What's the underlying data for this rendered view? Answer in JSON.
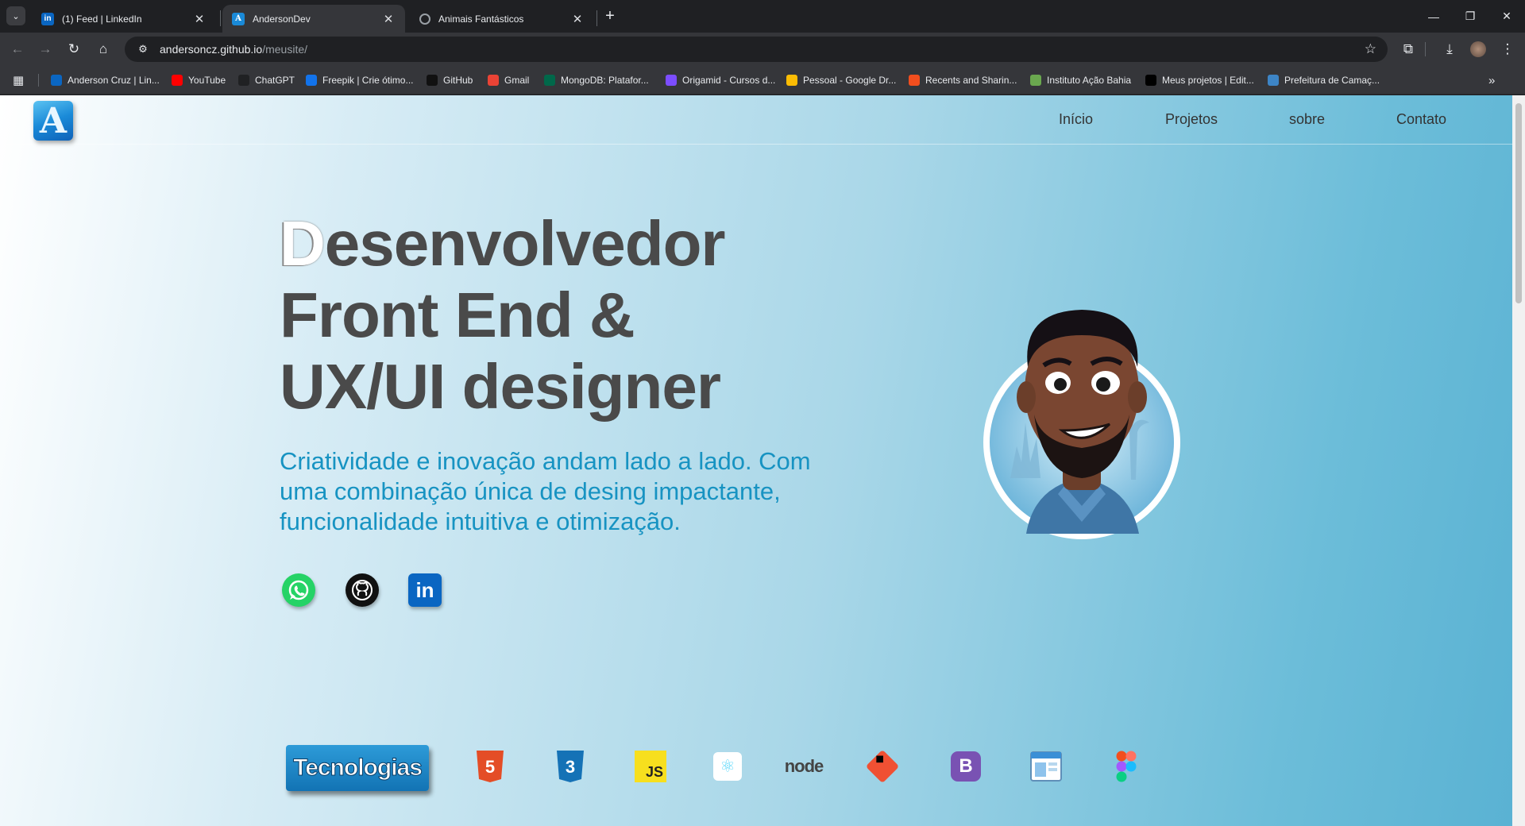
{
  "browser": {
    "tabs": [
      {
        "title": "(1) Feed | LinkedIn",
        "active": false,
        "favicon": "linkedin-icon",
        "color": "#0a66c2"
      },
      {
        "title": "AndersonDev",
        "active": true,
        "favicon": "site-logo-icon",
        "color": "#1a8ad8"
      },
      {
        "title": "Animais Fantásticos",
        "active": false,
        "favicon": "globe-icon",
        "color": "#9aa0a6"
      }
    ],
    "url_host": "andersoncz.github.io",
    "url_path": "/meusite/",
    "bookmarks": [
      {
        "label": "Anderson Cruz | Lin...",
        "icon": "linkedin-icon",
        "color": "#0a66c2"
      },
      {
        "label": "YouTube",
        "icon": "youtube-icon",
        "color": "#ff0000"
      },
      {
        "label": "ChatGPT",
        "icon": "chatgpt-icon",
        "color": "#202123"
      },
      {
        "label": "Freepik | Crie ótimo...",
        "icon": "freepik-icon",
        "color": "#1273eb"
      },
      {
        "label": "GitHub",
        "icon": "github-icon",
        "color": "#111111"
      },
      {
        "label": "Gmail",
        "icon": "gmail-icon",
        "color": "#ea4335"
      },
      {
        "label": "MongoDB: Platafor...",
        "icon": "mongodb-icon",
        "color": "#00684a"
      },
      {
        "label": "Origamid - Cursos d...",
        "icon": "origamid-icon",
        "color": "#7c4dff"
      },
      {
        "label": "Pessoal - Google Dr...",
        "icon": "google-drive-icon",
        "color": "#fbbc04"
      },
      {
        "label": "Recents and Sharin...",
        "icon": "figma-icon",
        "color": "#f24e1e"
      },
      {
        "label": "Instituto Ação Bahia",
        "icon": "instituto-icon",
        "color": "#6aa84f"
      },
      {
        "label": "Meus projetos | Edit...",
        "icon": "capcut-icon",
        "color": "#000000"
      },
      {
        "label": "Prefeitura de Camaç...",
        "icon": "prefeitura-icon",
        "color": "#3d85c6"
      }
    ]
  },
  "site": {
    "logo_letter": "A",
    "nav": [
      "Início",
      "Projetos",
      "sobre",
      "Contato"
    ],
    "hero": {
      "title_first_letter": "D",
      "title_line1_rest": "esenvolvedor",
      "title_line2": "Front End &",
      "title_line3": "UX/UI designer",
      "subtitle": "Criatividade e inovação andam lado a lado. Com uma combinação única de desing impactante, funcionalidade intuitiva e otimização."
    },
    "social": [
      {
        "name": "whatsapp-icon",
        "color": "#25d366"
      },
      {
        "name": "github-icon",
        "color": "#111111"
      },
      {
        "name": "linkedin-icon",
        "color": "#0a66c2"
      }
    ],
    "tech_label": "Tecnologias",
    "tech_icons": [
      {
        "name": "html5-icon",
        "text": "5",
        "color": "#e44d26"
      },
      {
        "name": "css3-icon",
        "text": "3",
        "color": "#1572b6"
      },
      {
        "name": "javascript-icon",
        "text": "JS",
        "color": "#f7df1e"
      },
      {
        "name": "react-icon",
        "text": "⚛",
        "color": "#61dafb"
      },
      {
        "name": "nodejs-icon",
        "text": "node",
        "color": "#3c873a"
      },
      {
        "name": "git-icon",
        "text": "◆",
        "color": "#f05033"
      },
      {
        "name": "bootstrap-icon",
        "text": "B",
        "color": "#7952b3"
      },
      {
        "name": "web-window-icon",
        "text": "",
        "color": "#3a8fd6"
      },
      {
        "name": "figma-icon",
        "text": "",
        "color": "#a259ff"
      },
      {
        "name": "tailwind-icon",
        "text": "≈",
        "color": "#38bdf8"
      }
    ]
  }
}
